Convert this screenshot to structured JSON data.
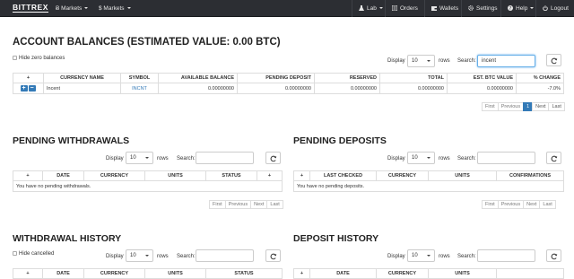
{
  "nav": {
    "brand": "BITTREX",
    "btc_markets": "Ƀ Markets",
    "usd_markets": "$ Markets",
    "lab": "Lab",
    "orders": "Orders",
    "wallets": "Wallets",
    "settings": "Settings",
    "help": "Help",
    "logout": "Logout"
  },
  "balances": {
    "title": "ACCOUNT BALANCES (ESTIMATED VALUE: 0.00 BTC)",
    "hide_zero": "Hide zero balances",
    "display_label": "Display",
    "display_value": "10",
    "rows_label": "rows",
    "search_label": "Search:",
    "search_value": "incent",
    "columns": [
      "+",
      "CURRENCY NAME",
      "SYMBOL",
      "AVAILABLE BALANCE",
      "PENDING DEPOSIT",
      "RESERVED",
      "TOTAL",
      "EST. BTC VALUE",
      "% CHANGE"
    ],
    "row": {
      "name": "Incent",
      "symbol": "INCNT",
      "available": "0.00000000",
      "pending": "0.00000000",
      "reserved": "0.00000000",
      "total": "0.00000000",
      "btc_value": "0.00000000",
      "change": "-7.0%"
    },
    "pager": [
      "First",
      "Previous",
      "1",
      "Next",
      "Last"
    ]
  },
  "withdrawals": {
    "title": "PENDING WITHDRAWALS",
    "display_label": "Display",
    "display_value": "10",
    "rows_label": "rows",
    "search_label": "Search:",
    "columns": [
      "+",
      "DATE",
      "CURRENCY",
      "UNITS",
      "STATUS",
      "+"
    ],
    "empty": "You have no pending withdrawals.",
    "pager": [
      "First",
      "Previous",
      "Next",
      "Last"
    ]
  },
  "deposits": {
    "title": "PENDING DEPOSITS",
    "display_label": "Display",
    "display_value": "10",
    "rows_label": "rows",
    "search_label": "Search:",
    "columns": [
      "+",
      "LAST CHECKED",
      "CURRENCY",
      "UNITS",
      "CONFIRMATIONS"
    ],
    "empty": "You have no pending deposits.",
    "pager": [
      "First",
      "Previous",
      "Next",
      "Last"
    ]
  },
  "withdrawal_history": {
    "title": "WITHDRAWAL HISTORY",
    "hide_cancelled": "Hide cancelled",
    "display_label": "Display",
    "display_value": "10",
    "rows_label": "rows",
    "search_label": "Search:",
    "columns": [
      "+",
      "DATE",
      "CURRENCY",
      "UNITS",
      "STATUS"
    ]
  },
  "deposit_history": {
    "title": "DEPOSIT HISTORY",
    "display_label": "Display",
    "display_value": "10",
    "rows_label": "rows",
    "search_label": "Search:",
    "columns": [
      "+",
      "DATE",
      "CURRENCY",
      "UNITS"
    ]
  }
}
